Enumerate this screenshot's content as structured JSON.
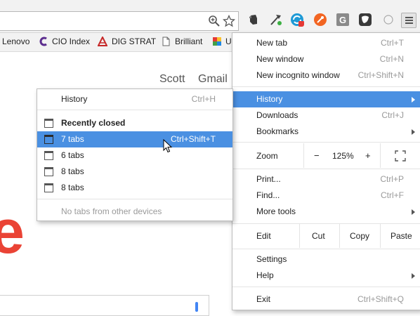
{
  "bookmarks": [
    {
      "label": "Lenovo",
      "icon": "folder-icon"
    },
    {
      "label": "CIO Index",
      "icon": "cio-logo-icon"
    },
    {
      "label": "DIG STRAT",
      "icon": "red-logo-icon"
    },
    {
      "label": "Brilliant",
      "icon": "page-icon"
    },
    {
      "label": "U",
      "icon": "multicolor-logo-icon"
    }
  ],
  "page": {
    "user_name": "Scott",
    "gmail": "Gmail",
    "logo_fragment": "e"
  },
  "main_menu": {
    "new_tab": {
      "label": "New tab",
      "shortcut": "Ctrl+T"
    },
    "new_window": {
      "label": "New window",
      "shortcut": "Ctrl+N"
    },
    "new_incognito": {
      "label": "New incognito window",
      "shortcut": "Ctrl+Shift+N"
    },
    "history": {
      "label": "History"
    },
    "downloads": {
      "label": "Downloads",
      "shortcut": "Ctrl+J"
    },
    "bookmarks": {
      "label": "Bookmarks"
    },
    "zoom": {
      "label": "Zoom",
      "minus": "−",
      "value": "125%",
      "plus": "+"
    },
    "print": {
      "label": "Print...",
      "shortcut": "Ctrl+P"
    },
    "find": {
      "label": "Find...",
      "shortcut": "Ctrl+F"
    },
    "more_tools": {
      "label": "More tools"
    },
    "edit": {
      "label": "Edit",
      "cut": "Cut",
      "copy": "Copy",
      "paste": "Paste"
    },
    "settings": {
      "label": "Settings"
    },
    "help": {
      "label": "Help"
    },
    "exit": {
      "label": "Exit",
      "shortcut": "Ctrl+Shift+Q"
    }
  },
  "history_menu": {
    "history": {
      "label": "History",
      "shortcut": "Ctrl+H"
    },
    "recently_closed": "Recently closed",
    "tabs": [
      {
        "label": "7 tabs",
        "shortcut": "Ctrl+Shift+T"
      },
      {
        "label": "6 tabs",
        "shortcut": ""
      },
      {
        "label": "8 tabs",
        "shortcut": ""
      },
      {
        "label": "8 tabs",
        "shortcut": ""
      }
    ],
    "no_other_devices": "No tabs from other devices"
  },
  "colors": {
    "highlight": "#4a90e2",
    "logo_red": "#ea4335"
  }
}
